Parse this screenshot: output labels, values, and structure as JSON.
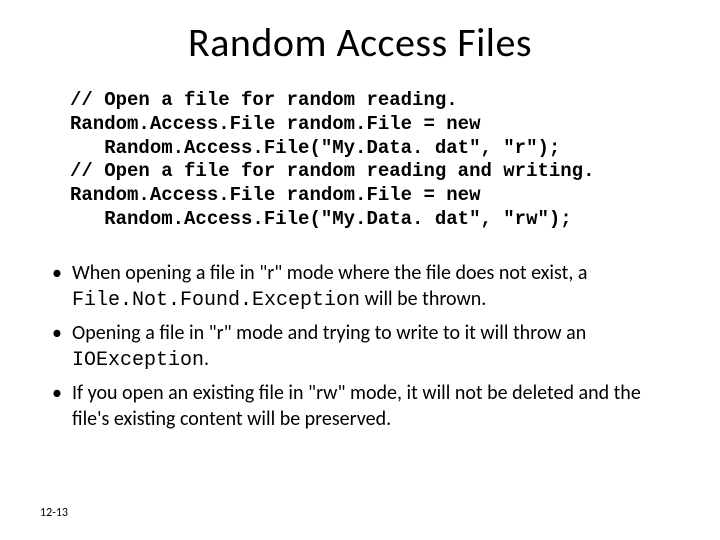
{
  "title": "Random Access Files",
  "code": {
    "l1": "// Open a file for random reading.",
    "l2": "Random.Access.File random.File = new",
    "l3": "   Random.Access.File(\"My.Data. dat\", \"r\");",
    "l4": "// Open a file for random reading and writing.",
    "l5": "Random.Access.File random.File = new",
    "l6": "   Random.Access.File(\"My.Data. dat\", \"rw\");"
  },
  "bullets": {
    "b1a": "When opening a file in \"r\" mode where the file does not exist, a ",
    "b1b": "File.Not.Found.Exception",
    "b1c": " will be thrown.",
    "b2a": "Opening a file in \"r\" mode and trying to write to it will throw an ",
    "b2b": "IOException",
    "b2c": ".",
    "b3": "If you open an existing file in \"rw\" mode, it will not be deleted and the file's existing content will be preserved."
  },
  "footer": "12-13"
}
